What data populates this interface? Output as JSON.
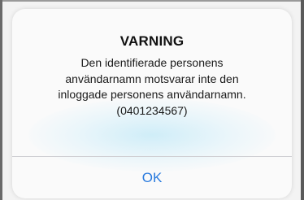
{
  "alert": {
    "title": "VARNING",
    "message_lines": [
      "Den identifierade personens",
      "användarnamn motsvarar inte den",
      "inloggade personens användarnamn.",
      "(0401234567)"
    ],
    "ok_label": "OK"
  },
  "colors": {
    "button_text": "#2a7bde",
    "title_text": "#111111",
    "alert_background": "#fafafa"
  }
}
